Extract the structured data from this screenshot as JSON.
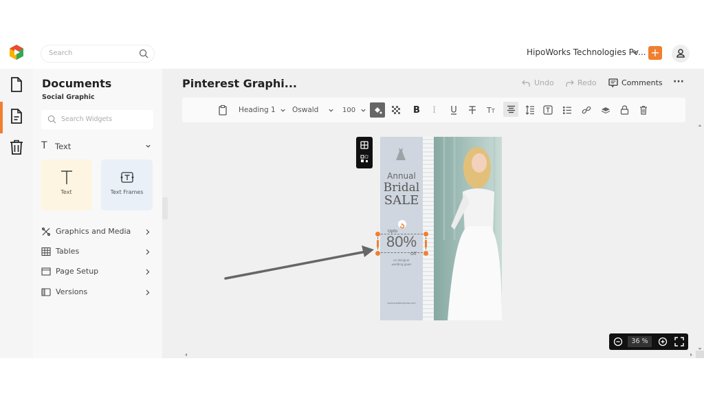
{
  "topbar": {
    "search_placeholder": "Search",
    "org_name": "HipoWorks Technologies Pv...",
    "add_label": "+"
  },
  "rail": {
    "items": [
      {
        "icon": "file-icon",
        "active": false
      },
      {
        "icon": "document-icon",
        "active": true
      },
      {
        "icon": "trash-icon",
        "active": false
      }
    ]
  },
  "panel": {
    "title": "Documents",
    "subtitle": "Social Graphic",
    "search_placeholder": "Search Widgets",
    "text_section": {
      "label": "Text",
      "expanded": true,
      "cards": [
        {
          "label": "Text",
          "icon": "text-icon"
        },
        {
          "label": "Text Frames",
          "icon": "text-frame-icon"
        }
      ]
    },
    "menu": [
      {
        "label": "Graphics and Media",
        "icon": "graphics-icon"
      },
      {
        "label": "Tables",
        "icon": "table-icon"
      },
      {
        "label": "Page Setup",
        "icon": "page-setup-icon"
      },
      {
        "label": "Versions",
        "icon": "versions-icon"
      }
    ]
  },
  "main": {
    "doc_title": "Pinterest Graphi...",
    "actions": {
      "undo": "Undo",
      "redo": "Redo",
      "comments": "Comments",
      "more": "···"
    },
    "toolbar": {
      "style": "Heading 1",
      "font": "Oswald",
      "size": "100",
      "buttons": [
        "paste",
        "fill-color",
        "transparency",
        "bold",
        "italic",
        "underline",
        "strikethrough",
        "text-case",
        "align-center",
        "line-spacing",
        "text-box",
        "list",
        "link",
        "layers",
        "lock",
        "delete"
      ]
    },
    "design": {
      "annual": "Annual",
      "bridal": "Bridal",
      "sale": "SALE",
      "upto": "Upto",
      "percent": "80%",
      "off": "Off",
      "small_line1": "on designer",
      "small_line2": "wedding gown",
      "footer": "www.weddingshop.com"
    },
    "zoom": {
      "value": "36",
      "unit": "%"
    }
  }
}
